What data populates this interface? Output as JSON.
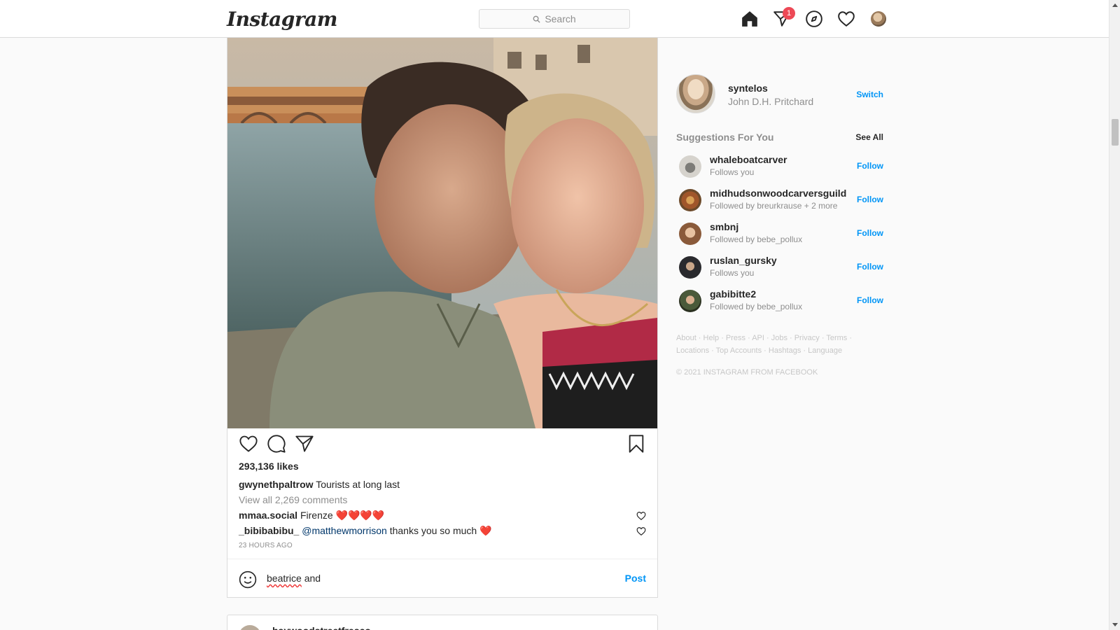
{
  "nav": {
    "logo": "Instagram",
    "search_placeholder": "Search",
    "notification_count": "1"
  },
  "post": {
    "likes": "293,136 likes",
    "caption_user": "gwynethpaltrow",
    "caption_text": "Tourists at long last",
    "view_all": "View all 2,269 comments",
    "comments": [
      {
        "user": "mmaa.social",
        "text": "Firenze ❤️❤️❤️❤️",
        "mention": ""
      },
      {
        "user": "_bibibabibu_",
        "mention": "@matthewmorrison",
        "text": "thanks you so much ❤️"
      }
    ],
    "timestamp": "23 HOURS AGO",
    "comment_draft_word1": "beatrice",
    "comment_draft_word2": "and",
    "post_button": "Post"
  },
  "next_post": {
    "user": "haywoodstreetfresco"
  },
  "sidebar": {
    "me": {
      "username": "syntelos",
      "fullname": "John D.H. Pritchard",
      "switch": "Switch"
    },
    "suggestions_title": "Suggestions For You",
    "see_all": "See All",
    "suggestions": [
      {
        "username": "whaleboatcarver",
        "subtitle": "Follows you",
        "action": "Follow"
      },
      {
        "username": "midhudsonwoodcarversguild",
        "subtitle": "Followed by breurkrause + 2 more",
        "action": "Follow"
      },
      {
        "username": "smbnj",
        "subtitle": "Followed by bebe_pollux",
        "action": "Follow"
      },
      {
        "username": "ruslan_gursky",
        "subtitle": "Follows you",
        "action": "Follow"
      },
      {
        "username": "gabibitte2",
        "subtitle": "Followed by bebe_pollux",
        "action": "Follow"
      }
    ],
    "footer_line1": "About · Help · Press · API · Jobs · Privacy · Terms ·",
    "footer_line2": "Locations · Top Accounts · Hashtags · Language",
    "copyright": "© 2021 INSTAGRAM FROM FACEBOOK"
  },
  "colors": {
    "accent": "#0095f6",
    "badge": "#ed4956",
    "heart": "#ed4956"
  }
}
